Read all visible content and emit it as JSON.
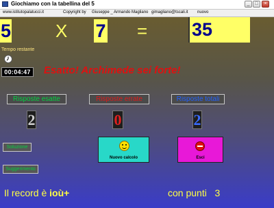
{
  "window": {
    "title": "Giochiamo con la tabellina del 5",
    "icon": "app-icon"
  },
  "menu": {
    "items": [
      "www.istitutopalatucci.it",
      "Copyright by",
      "Giuseppe _ Armando Magliano",
      "gimagliano@tscali.it",
      "nuovo"
    ]
  },
  "operation": {
    "operand_a": "5",
    "operator": "X",
    "operand_b": "7",
    "equals": "=",
    "answer": "35"
  },
  "timer": {
    "label": "Tempo restante",
    "value": "00:04:47",
    "icon": "clock-icon"
  },
  "feedback": {
    "message": "Esatto! Archimede sei forte!"
  },
  "scores": {
    "correct_label": "Risposte esatte",
    "wrong_label": "Risposte errate",
    "total_label": "Risposte totali",
    "correct": "2",
    "wrong": "0",
    "total": "2"
  },
  "side_buttons": {
    "first": "Soluzione",
    "second": "Suggerimento"
  },
  "actions": {
    "new_label": "Nuovo calcolo",
    "exit_label": "Esci",
    "new_icon": "smiley-icon",
    "exit_icon": "stop-icon"
  },
  "record": {
    "prefix": "Il record  è",
    "holder": "ioù+",
    "points_label": "con punti",
    "points": "3"
  },
  "colors": {
    "box_yellow": "#ffff66",
    "number_blue": "#00008b",
    "message_red": "#e01010",
    "correct_green": "#00d040",
    "wrong_red": "#e01818",
    "total_blue": "#2060ff",
    "new_button": "#28d8c8",
    "exit_button": "#e818d8"
  }
}
